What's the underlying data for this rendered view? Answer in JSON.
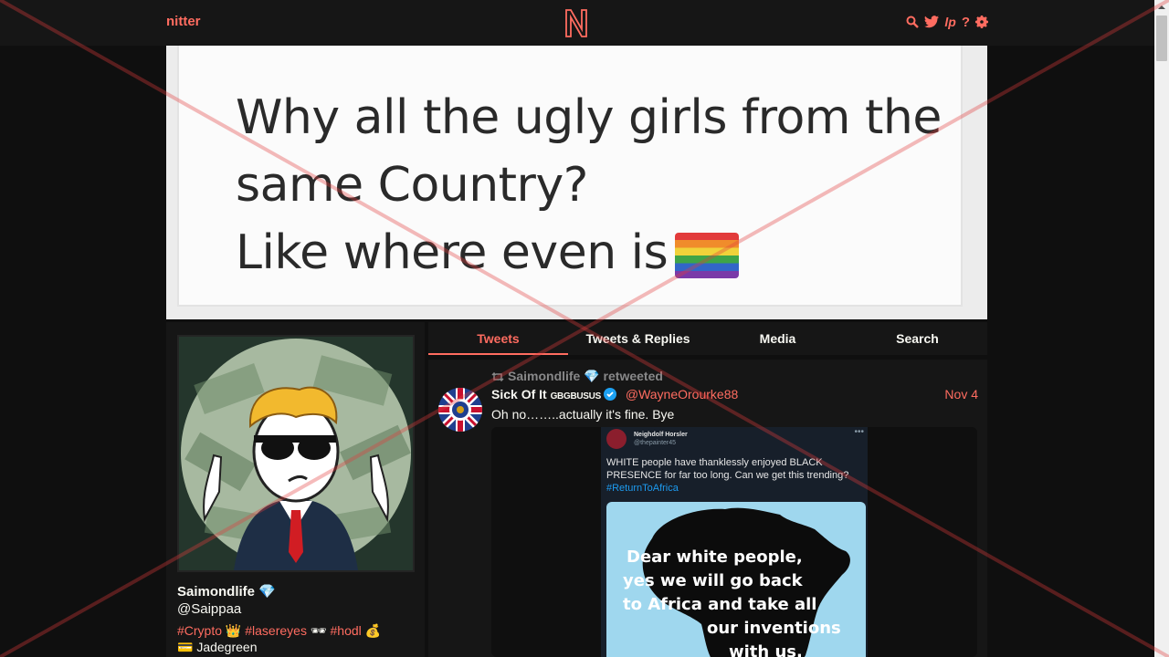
{
  "navbar": {
    "brand": "nitter",
    "logo_letter": "N",
    "icons": [
      "search-icon",
      "twitter-bird-icon",
      "liberapay-icon",
      "help-icon",
      "settings-icon"
    ]
  },
  "banner": {
    "lines": [
      "Why all the ugly girls from the",
      "same Country?",
      "Like where even is"
    ]
  },
  "profile": {
    "fullname": "Saimondlife 💎",
    "username": "@Saippaa",
    "bio_tags": [
      "#Crypto",
      "#lasereyes",
      "#hodl"
    ],
    "bio_emojis": [
      "👑",
      "🕶",
      "💰"
    ],
    "bio_line2": "💳  Jadegreen"
  },
  "tabs": [
    "Tweets",
    "Tweets & Replies",
    "Media",
    "Search"
  ],
  "tweet": {
    "retweet_by": "Saimondlife 💎  retweeted",
    "fullname": "Sick Of It",
    "fullname_suffix": "GBGBUSUS",
    "username": "@WayneOrourke88",
    "date": "Nov 4",
    "text": "Oh no……..actually it's fine. Bye",
    "embed": {
      "name": "Neighdolf Horsler",
      "handle": "@thepainter45",
      "text": "WHITE people have thanklessly enjoyed BLACK PRESENCE for far too long. Can we get this trending?",
      "hashtag": "#ReturnToAfrica",
      "poster_lines": [
        "Dear white people,",
        "yes we will go back",
        "to Africa and take all",
        "our inventions",
        "with us."
      ]
    }
  },
  "colors": {
    "accent": "#ff6c60",
    "bg": "#0f0f0f",
    "panel": "#161616"
  }
}
